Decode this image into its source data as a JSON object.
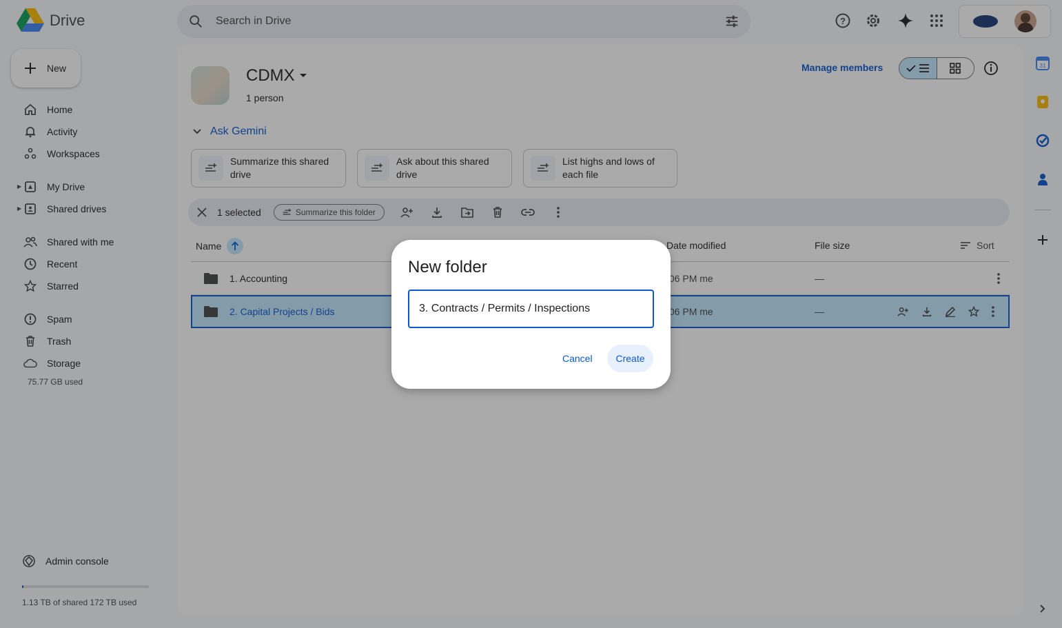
{
  "app": {
    "name": "Drive"
  },
  "search": {
    "placeholder": "Search in Drive"
  },
  "sidebar": {
    "new_label": "New",
    "items": [
      {
        "label": "Home",
        "icon": "home-icon"
      },
      {
        "label": "Activity",
        "icon": "bell-icon"
      },
      {
        "label": "Workspaces",
        "icon": "workspaces-icon"
      },
      {
        "label": "My Drive",
        "icon": "my-drive-icon"
      },
      {
        "label": "Shared drives",
        "icon": "shared-drives-icon"
      },
      {
        "label": "Shared with me",
        "icon": "people-icon"
      },
      {
        "label": "Recent",
        "icon": "clock-icon"
      },
      {
        "label": "Starred",
        "icon": "star-icon"
      },
      {
        "label": "Spam",
        "icon": "spam-icon"
      },
      {
        "label": "Trash",
        "icon": "trash-icon"
      },
      {
        "label": "Storage",
        "icon": "cloud-icon"
      }
    ],
    "storage_used": "75.77 GB used",
    "admin_console": "Admin console",
    "shared_storage": "1.13 TB of shared 172 TB used",
    "shared_storage_fraction": 0.0066
  },
  "header": {
    "drive_name": "CDMX",
    "members": "1 person",
    "manage_members": "Manage members"
  },
  "gemini": {
    "title": "Ask Gemini",
    "chips": [
      "Summarize this shared drive",
      "Ask about this shared drive",
      "List highs and lows of each file"
    ]
  },
  "selection_bar": {
    "count": "1 selected",
    "summarize_folder": "Summarize this folder"
  },
  "table": {
    "columns": {
      "name": "Name",
      "date_modified": "Date modified",
      "file_size": "File size",
      "sort": "Sort"
    },
    "rows": [
      {
        "name": "1. Accounting",
        "modified": ":06 PM me",
        "size": "—",
        "selected": false
      },
      {
        "name": "2. Capital Projects / Bids",
        "modified": ":06 PM me",
        "size": "—",
        "selected": true
      }
    ]
  },
  "dialog": {
    "title": "New folder",
    "input_value": "3. Contracts / Permits / Inspections",
    "cancel": "Cancel",
    "create": "Create"
  },
  "colors": {
    "accent": "#0b57d0",
    "selected_bg": "#c2e7ff",
    "sidebar_bg": "#f8fafd"
  }
}
